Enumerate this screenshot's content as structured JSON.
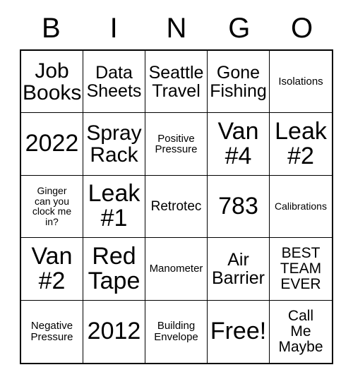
{
  "card": {
    "title": "BINGO",
    "header_letters": [
      "B",
      "I",
      "N",
      "G",
      "O"
    ],
    "background_color": "#ffffff",
    "line_color": "#000000",
    "text_color": "#000000",
    "rows": 5,
    "columns": 5,
    "cells": [
      {
        "text": "Job\nBooks",
        "size": "lg"
      },
      {
        "text": "Data\nSheets",
        "size": "md"
      },
      {
        "text": "Seattle\nTravel",
        "size": "md"
      },
      {
        "text": "Gone\nFishing",
        "size": "md"
      },
      {
        "text": "Isolations",
        "size": "xxs"
      },
      {
        "text": "2022",
        "size": "xl"
      },
      {
        "text": "Spray\nRack",
        "size": "lg"
      },
      {
        "text": "Positive\nPressure",
        "size": "xxs"
      },
      {
        "text": "Van\n#4",
        "size": "xl"
      },
      {
        "text": "Leak\n#2",
        "size": "xl"
      },
      {
        "text": "Ginger\ncan you\nclock me\nin?",
        "size": "tiny"
      },
      {
        "text": "Leak\n#1",
        "size": "xl"
      },
      {
        "text": "Retrotec",
        "size": "xs"
      },
      {
        "text": "783",
        "size": "xl"
      },
      {
        "text": "Calibrations",
        "size": "tiny"
      },
      {
        "text": "Van\n#2",
        "size": "xl"
      },
      {
        "text": "Red\nTape",
        "size": "xl"
      },
      {
        "text": "Manometer",
        "size": "xxs"
      },
      {
        "text": "Air\nBarrier",
        "size": "md"
      },
      {
        "text": "BEST\nTEAM\nEVER",
        "size": "sm"
      },
      {
        "text": "Negative\nPressure",
        "size": "xxs"
      },
      {
        "text": "2012",
        "size": "xl"
      },
      {
        "text": "Building\nEnvelope",
        "size": "xxs"
      },
      {
        "text": "Free!",
        "size": "xl"
      },
      {
        "text": "Call\nMe\nMaybe",
        "size": "sm"
      }
    ]
  }
}
